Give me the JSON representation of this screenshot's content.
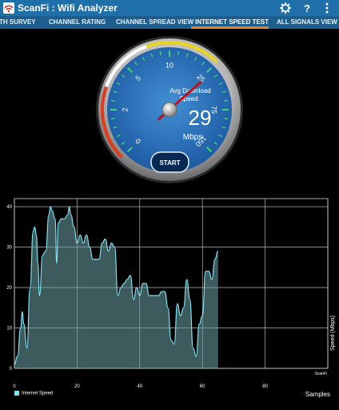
{
  "app": {
    "title": "ScanFi : Wifi Analyzer"
  },
  "tabs": [
    {
      "label": "TH SURVEY"
    },
    {
      "label": "CHANNEL RATING"
    },
    {
      "label": "CHANNEL SPREAD VIEW"
    },
    {
      "label": "INTERNET SPEED TEST",
      "active": true
    },
    {
      "label": "ALL SIGNALS VIEW"
    }
  ],
  "gauge": {
    "caption_line1": "Avg Download",
    "caption_line2": "Speed",
    "value": 29,
    "value_text": "29",
    "unit": "Mbps",
    "start_label": "START",
    "scale_labels": [
      "0",
      "2",
      "5",
      "10",
      "25",
      "75",
      "150"
    ]
  },
  "chart": {
    "ylabel": "Speed (Mbps)",
    "xlabel": "Samples",
    "watermark": "ScanFi",
    "legend": "Internet Speed"
  },
  "chart_data": {
    "type": "area",
    "xlim": [
      0,
      100
    ],
    "ylim": [
      0,
      42
    ],
    "x_ticks": [
      "0",
      "20",
      "40",
      "60",
      "80"
    ],
    "y_ticks": [
      "0",
      "10",
      "20",
      "30",
      "40"
    ],
    "grid": true,
    "legend_position": "bottom-left",
    "series": [
      {
        "name": "Internet Speed",
        "color": "#7fe0f0",
        "x": [
          0,
          1,
          2,
          2.5,
          3,
          4,
          5,
          6,
          6.5,
          7,
          7.5,
          8,
          9,
          10,
          11,
          11.5,
          12,
          13,
          13.5,
          14,
          15,
          16,
          17,
          17.5,
          18,
          19,
          20,
          21,
          22,
          23,
          24,
          25,
          26,
          27,
          28,
          29,
          30,
          31,
          32,
          33,
          34,
          35,
          36,
          37,
          38,
          39,
          40,
          41,
          42,
          43,
          44,
          45,
          46,
          47,
          48,
          49,
          50,
          51,
          52,
          53,
          54,
          55,
          56,
          57,
          58,
          59,
          60,
          61,
          62,
          63,
          64,
          65
        ],
        "values": [
          1,
          3,
          10,
          14,
          11,
          5,
          20,
          34,
          35,
          33,
          26,
          18,
          28,
          29,
          38,
          40,
          39,
          37,
          26,
          36,
          37,
          37,
          38,
          40,
          38,
          35,
          31,
          33,
          31,
          33,
          30,
          27,
          27,
          27,
          31,
          32,
          29,
          31,
          30,
          18,
          20,
          21,
          22,
          23,
          17,
          20,
          18,
          21,
          21,
          18,
          18,
          18,
          18,
          19,
          19,
          15,
          7,
          6,
          16,
          13,
          15,
          22,
          17,
          5,
          3,
          11,
          13,
          24,
          24,
          22,
          27,
          29
        ]
      }
    ]
  }
}
